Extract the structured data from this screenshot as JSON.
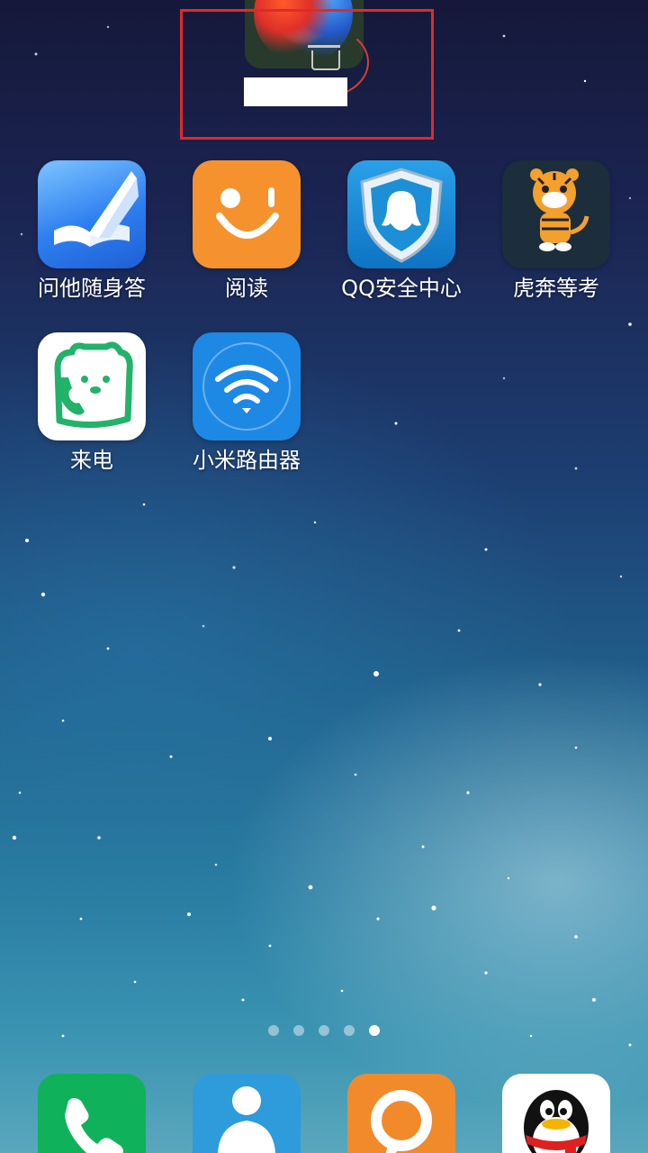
{
  "home": {
    "apps": [
      {
        "name": "wenta-app",
        "label": "问他随身答"
      },
      {
        "name": "reader-app",
        "label": "阅读"
      },
      {
        "name": "qq-security-app",
        "label": "QQ安全中心"
      },
      {
        "name": "huben-app",
        "label": "虎奔等考"
      },
      {
        "name": "laidian-app",
        "label": "来电"
      },
      {
        "name": "mi-router-app",
        "label": "小米路由器"
      }
    ],
    "page_indicator": {
      "count": 5,
      "current": 5
    }
  },
  "colors": {
    "highlight": "#e02a2a",
    "reader_orange": "#f5922e",
    "qq_blue": "#1d8fd6",
    "router_blue": "#1e88e5",
    "phone_green": "#0fb25a"
  },
  "icons": [
    "book-icon",
    "smile-icon",
    "shield-penguin-icon",
    "tiger-icon",
    "bear-phone-icon",
    "wifi-icon",
    "phone-icon",
    "contacts-icon",
    "message-icon",
    "qq-penguin-icon",
    "trash-icon"
  ]
}
